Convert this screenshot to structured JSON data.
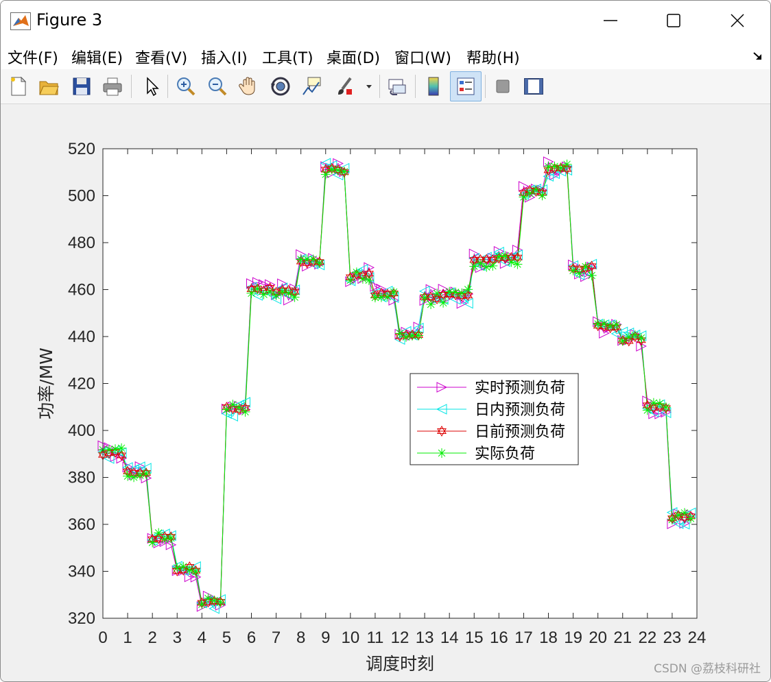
{
  "window": {
    "title": "Figure 3"
  },
  "menu": [
    "文件(F)",
    "编辑(E)",
    "查看(V)",
    "插入(I)",
    "工具(T)",
    "桌面(D)",
    "窗口(W)",
    "帮助(H)"
  ],
  "toolbar_icons": [
    "new-figure-icon",
    "open-file-icon",
    "save-icon",
    "print-icon",
    "pointer-icon",
    "zoom-in-icon",
    "zoom-out-icon",
    "pan-hand-icon",
    "rotate-3d-icon",
    "data-cursor-icon",
    "brush-icon",
    "link-plot-icon",
    "colorbar-icon",
    "legend-icon",
    "hide-plot-tools-icon",
    "show-plot-tools-icon"
  ],
  "watermark": "CSDN @荔枝科研社",
  "colors": {
    "series1": "#cc00cc",
    "series2": "#00e5e5",
    "series3": "#dd0000",
    "series4": "#00ee00"
  },
  "chart_data": {
    "type": "line",
    "xlabel": "调度时刻",
    "ylabel": "功率/MW",
    "xlim": [
      0,
      24
    ],
    "ylim": [
      320,
      520
    ],
    "xticks": [
      0,
      1,
      2,
      3,
      4,
      5,
      6,
      7,
      8,
      9,
      10,
      11,
      12,
      13,
      14,
      15,
      16,
      17,
      18,
      19,
      20,
      21,
      22,
      23,
      24
    ],
    "yticks": [
      320,
      340,
      360,
      380,
      400,
      420,
      440,
      460,
      480,
      500,
      520
    ],
    "legend_location": "center-right",
    "grid": false,
    "hourly_levels": {
      "hours": [
        0,
        1,
        2,
        3,
        4,
        5,
        6,
        7,
        8,
        9,
        10,
        11,
        12,
        13,
        14,
        15,
        16,
        17,
        18,
        19,
        20,
        21,
        22,
        23
      ],
      "actual": [
        391,
        382,
        354,
        341,
        327,
        409,
        460,
        458,
        472,
        511,
        466,
        458,
        440,
        456,
        458,
        471,
        473,
        501,
        511,
        468,
        443,
        440,
        411,
        364
      ],
      "day_ahead": [
        390,
        382,
        354,
        341,
        327,
        409,
        460,
        459,
        472,
        511,
        466,
        458,
        441,
        457,
        457,
        472,
        474,
        502,
        511,
        469,
        444,
        439,
        410,
        363
      ]
    },
    "series": [
      {
        "name": "实时预测负荷",
        "marker": "triangle-right",
        "color": "#cc00cc"
      },
      {
        "name": "日内预测负荷",
        "marker": "triangle-left",
        "color": "#00e5e5"
      },
      {
        "name": "日前预测负荷",
        "marker": "hexagram",
        "color": "#dd0000"
      },
      {
        "name": "实际负荷",
        "marker": "asterisk",
        "color": "#00ee00"
      }
    ]
  }
}
